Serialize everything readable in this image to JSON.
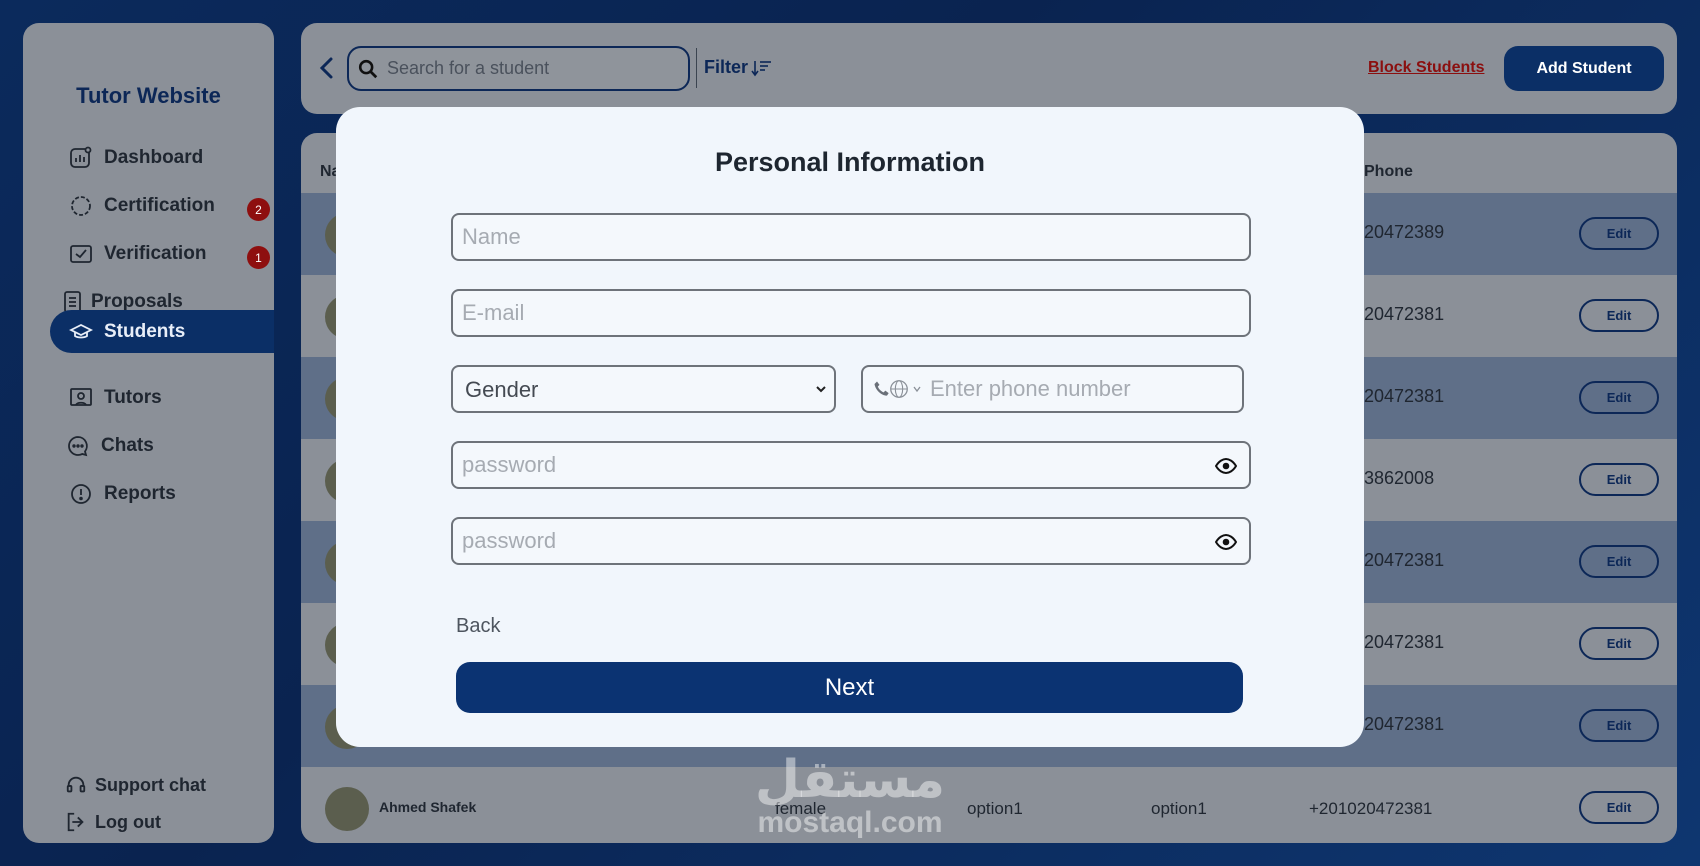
{
  "brand": "Tutor Website",
  "sidebar": {
    "items": [
      {
        "label": "Dashboard",
        "icon": "chart-icon"
      },
      {
        "label": "Certification",
        "icon": "certificate-icon",
        "badge": "2"
      },
      {
        "label": "Verification",
        "icon": "checkbox-icon",
        "badge": "1"
      },
      {
        "label": "Proposals",
        "icon": "document-icon"
      },
      {
        "label": "Students",
        "icon": "graduation-cap-icon",
        "active": true
      },
      {
        "label": "Tutors",
        "icon": "tutor-board-icon"
      },
      {
        "label": "Chats",
        "icon": "chat-bubble-icon"
      },
      {
        "label": "Reports",
        "icon": "alert-circle-icon"
      }
    ],
    "support": "Support chat",
    "logout": "Log out"
  },
  "topbar": {
    "search_placeholder": "Search for a student",
    "filter_label": "Filter",
    "block_label": "Block Students",
    "add_label": "Add Student"
  },
  "table": {
    "name_header": "Na",
    "phone_header": "Phone",
    "edit_label": "Edit",
    "rows": [
      {
        "phone": "20472389"
      },
      {
        "phone": "20472381"
      },
      {
        "phone": "20472381"
      },
      {
        "phone": "3862008"
      },
      {
        "phone": "20472381"
      },
      {
        "phone": "20472381"
      },
      {
        "phone": "20472381"
      },
      {
        "name": "Ahmed Shafek",
        "gender": "female",
        "col1": "option1",
        "col2": "option1",
        "phone": "+201020472381"
      }
    ]
  },
  "modal": {
    "title": "Personal Information",
    "name_placeholder": "Name",
    "email_placeholder": "E-mail",
    "gender_label": "Gender",
    "phone_placeholder": "Enter phone number",
    "password_placeholder": "password",
    "confirm_placeholder": "password",
    "back_label": "Back",
    "next_label": "Next"
  },
  "watermark": {
    "arabic": "مستقل",
    "latin": "mostaql.com"
  },
  "colors": {
    "primary": "#0b2f66",
    "danger": "#8b0f0f",
    "panel": "#8b9098",
    "modal_bg": "#f1f6fc"
  }
}
